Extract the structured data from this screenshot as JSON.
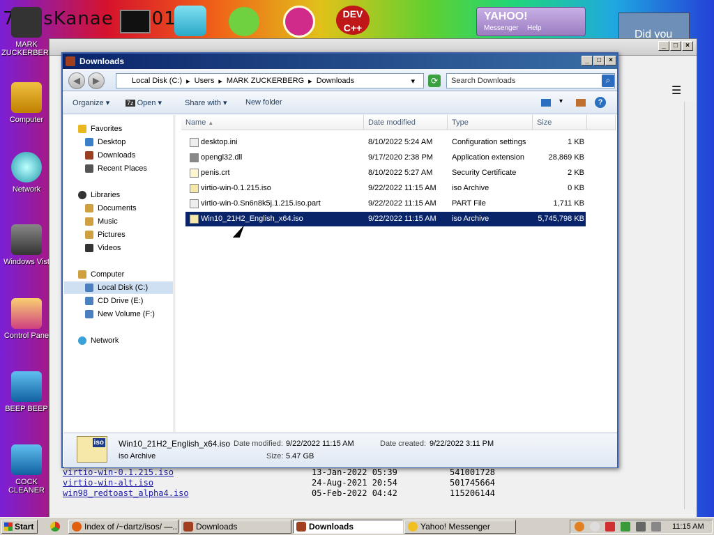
{
  "desktop": {
    "banner_text": "7 ossKanae tio 012",
    "icons": [
      {
        "label": "MARK ZUCKERBERG"
      },
      {
        "label": "Computer"
      },
      {
        "label": "Network"
      },
      {
        "label": "Windows Vist"
      },
      {
        "label": "Control Pane"
      },
      {
        "label": "BEEP BEEP"
      },
      {
        "label": "COCK CLEANER"
      }
    ],
    "dev_icon": "DEV C++",
    "yahoo_badge": "YAHOO!",
    "yahoo_sub": "Messenger",
    "yahoo_help": "Help",
    "did_you": "Did you"
  },
  "browser": {
    "listing": [
      {
        "name": "virtio-win-0.1.215.iso",
        "date": "13-Jan-2022 05:39",
        "size": "541001728"
      },
      {
        "name": "virtio-win-alt.iso",
        "date": "24-Aug-2021 20:54",
        "size": "501745664"
      },
      {
        "name": "win98_redtoast_alpha4.iso",
        "date": "05-Feb-2022 04:42",
        "size": "115206144"
      }
    ]
  },
  "explorer": {
    "title": "Downloads",
    "breadcrumb": [
      "Local Disk (C:)",
      "Users",
      "MARK ZUCKERBERG",
      "Downloads"
    ],
    "search_placeholder": "Search Downloads",
    "toolbar": {
      "organize": "Organize",
      "open": "Open",
      "share": "Share with",
      "new_folder": "New folder"
    },
    "nav": {
      "favorites": "Favorites",
      "fav_items": [
        "Desktop",
        "Downloads",
        "Recent Places"
      ],
      "libraries": "Libraries",
      "lib_items": [
        "Documents",
        "Music",
        "Pictures",
        "Videos"
      ],
      "computer": "Computer",
      "comp_items": [
        "Local Disk (C:)",
        "CD Drive (E:)",
        "New Volume (F:)"
      ],
      "network": "Network"
    },
    "columns": {
      "name": "Name",
      "date": "Date modified",
      "type": "Type",
      "size": "Size"
    },
    "files": [
      {
        "name": "desktop.ini",
        "date": "8/10/2022 5:24 AM",
        "type": "Configuration settings",
        "size": "1 KB"
      },
      {
        "name": "opengl32.dll",
        "date": "9/17/2020 2:38 PM",
        "type": "Application extension",
        "size": "28,869 KB"
      },
      {
        "name": "penis.crt",
        "date": "8/10/2022 5:27 AM",
        "type": "Security Certificate",
        "size": "2 KB"
      },
      {
        "name": "virtio-win-0.1.215.iso",
        "date": "9/22/2022 11:15 AM",
        "type": "iso Archive",
        "size": "0 KB"
      },
      {
        "name": "virtio-win-0.Sn6n8k5j.1.215.iso.part",
        "date": "9/22/2022 11:15 AM",
        "type": "PART File",
        "size": "1,711 KB"
      },
      {
        "name": "Win10_21H2_English_x64.iso",
        "date": "9/22/2022 11:15 AM",
        "type": "iso Archive",
        "size": "5,745,798 KB"
      }
    ],
    "details": {
      "icon_text": "iso",
      "name": "Win10_21H2_English_x64.iso",
      "type": "iso Archive",
      "modified_label": "Date modified:",
      "modified": "9/22/2022 11:15 AM",
      "created_label": "Date created:",
      "created": "9/22/2022 3:11 PM",
      "size_label": "Size:",
      "size": "5.47 GB"
    }
  },
  "taskbar": {
    "start": "Start",
    "tasks": [
      "Index of /~dartz/isos/ —...",
      "Downloads",
      "Downloads",
      "Yahoo! Messenger"
    ],
    "clock": "11:15 AM"
  }
}
